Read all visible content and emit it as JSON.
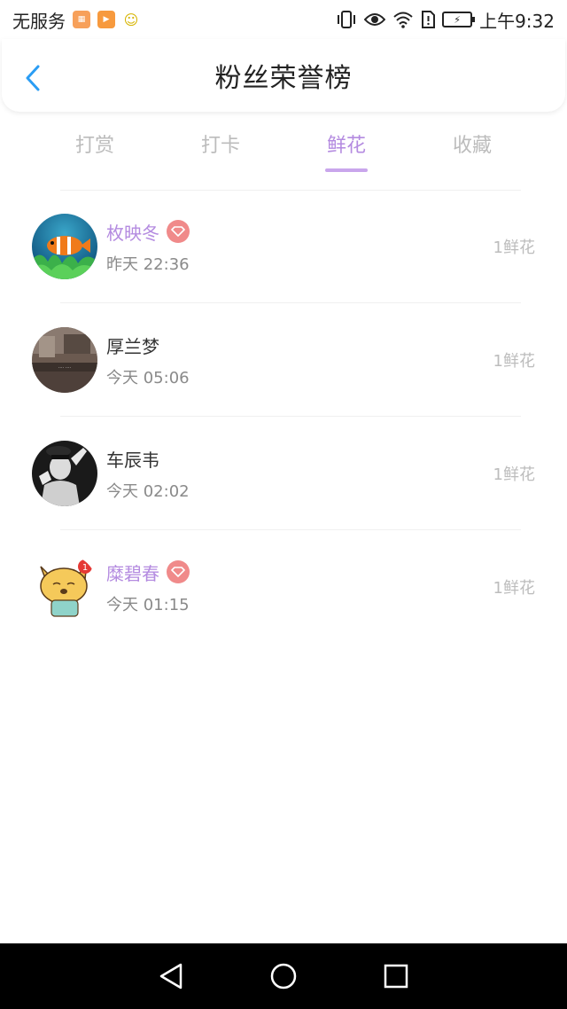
{
  "status_bar": {
    "carrier": "无服务",
    "time": "上午9:32"
  },
  "header": {
    "title": "粉丝荣誉榜"
  },
  "tabs": [
    {
      "label": "打赏",
      "active": false
    },
    {
      "label": "打卡",
      "active": false
    },
    {
      "label": "鲜花",
      "active": true
    },
    {
      "label": "收藏",
      "active": false
    }
  ],
  "list": [
    {
      "name": "枚映冬",
      "vip": true,
      "time": "昨天 22:36",
      "count": "1鲜花",
      "avatar": "clownfish-avatar"
    },
    {
      "name": "厚兰梦",
      "vip": false,
      "time": "今天 05:06",
      "count": "1鲜花",
      "avatar": "room-photo-avatar"
    },
    {
      "name": "车辰韦",
      "vip": false,
      "time": "今天 02:02",
      "count": "1鲜花",
      "avatar": "bw-person-avatar"
    },
    {
      "name": "糜碧春",
      "vip": true,
      "time": "今天 01:15",
      "count": "1鲜花",
      "avatar": "cartoon-fox-avatar"
    }
  ],
  "colors": {
    "accent": "#b48be0",
    "vip_badge": "#f08a8a",
    "inactive_tab": "#bcbcbc"
  }
}
